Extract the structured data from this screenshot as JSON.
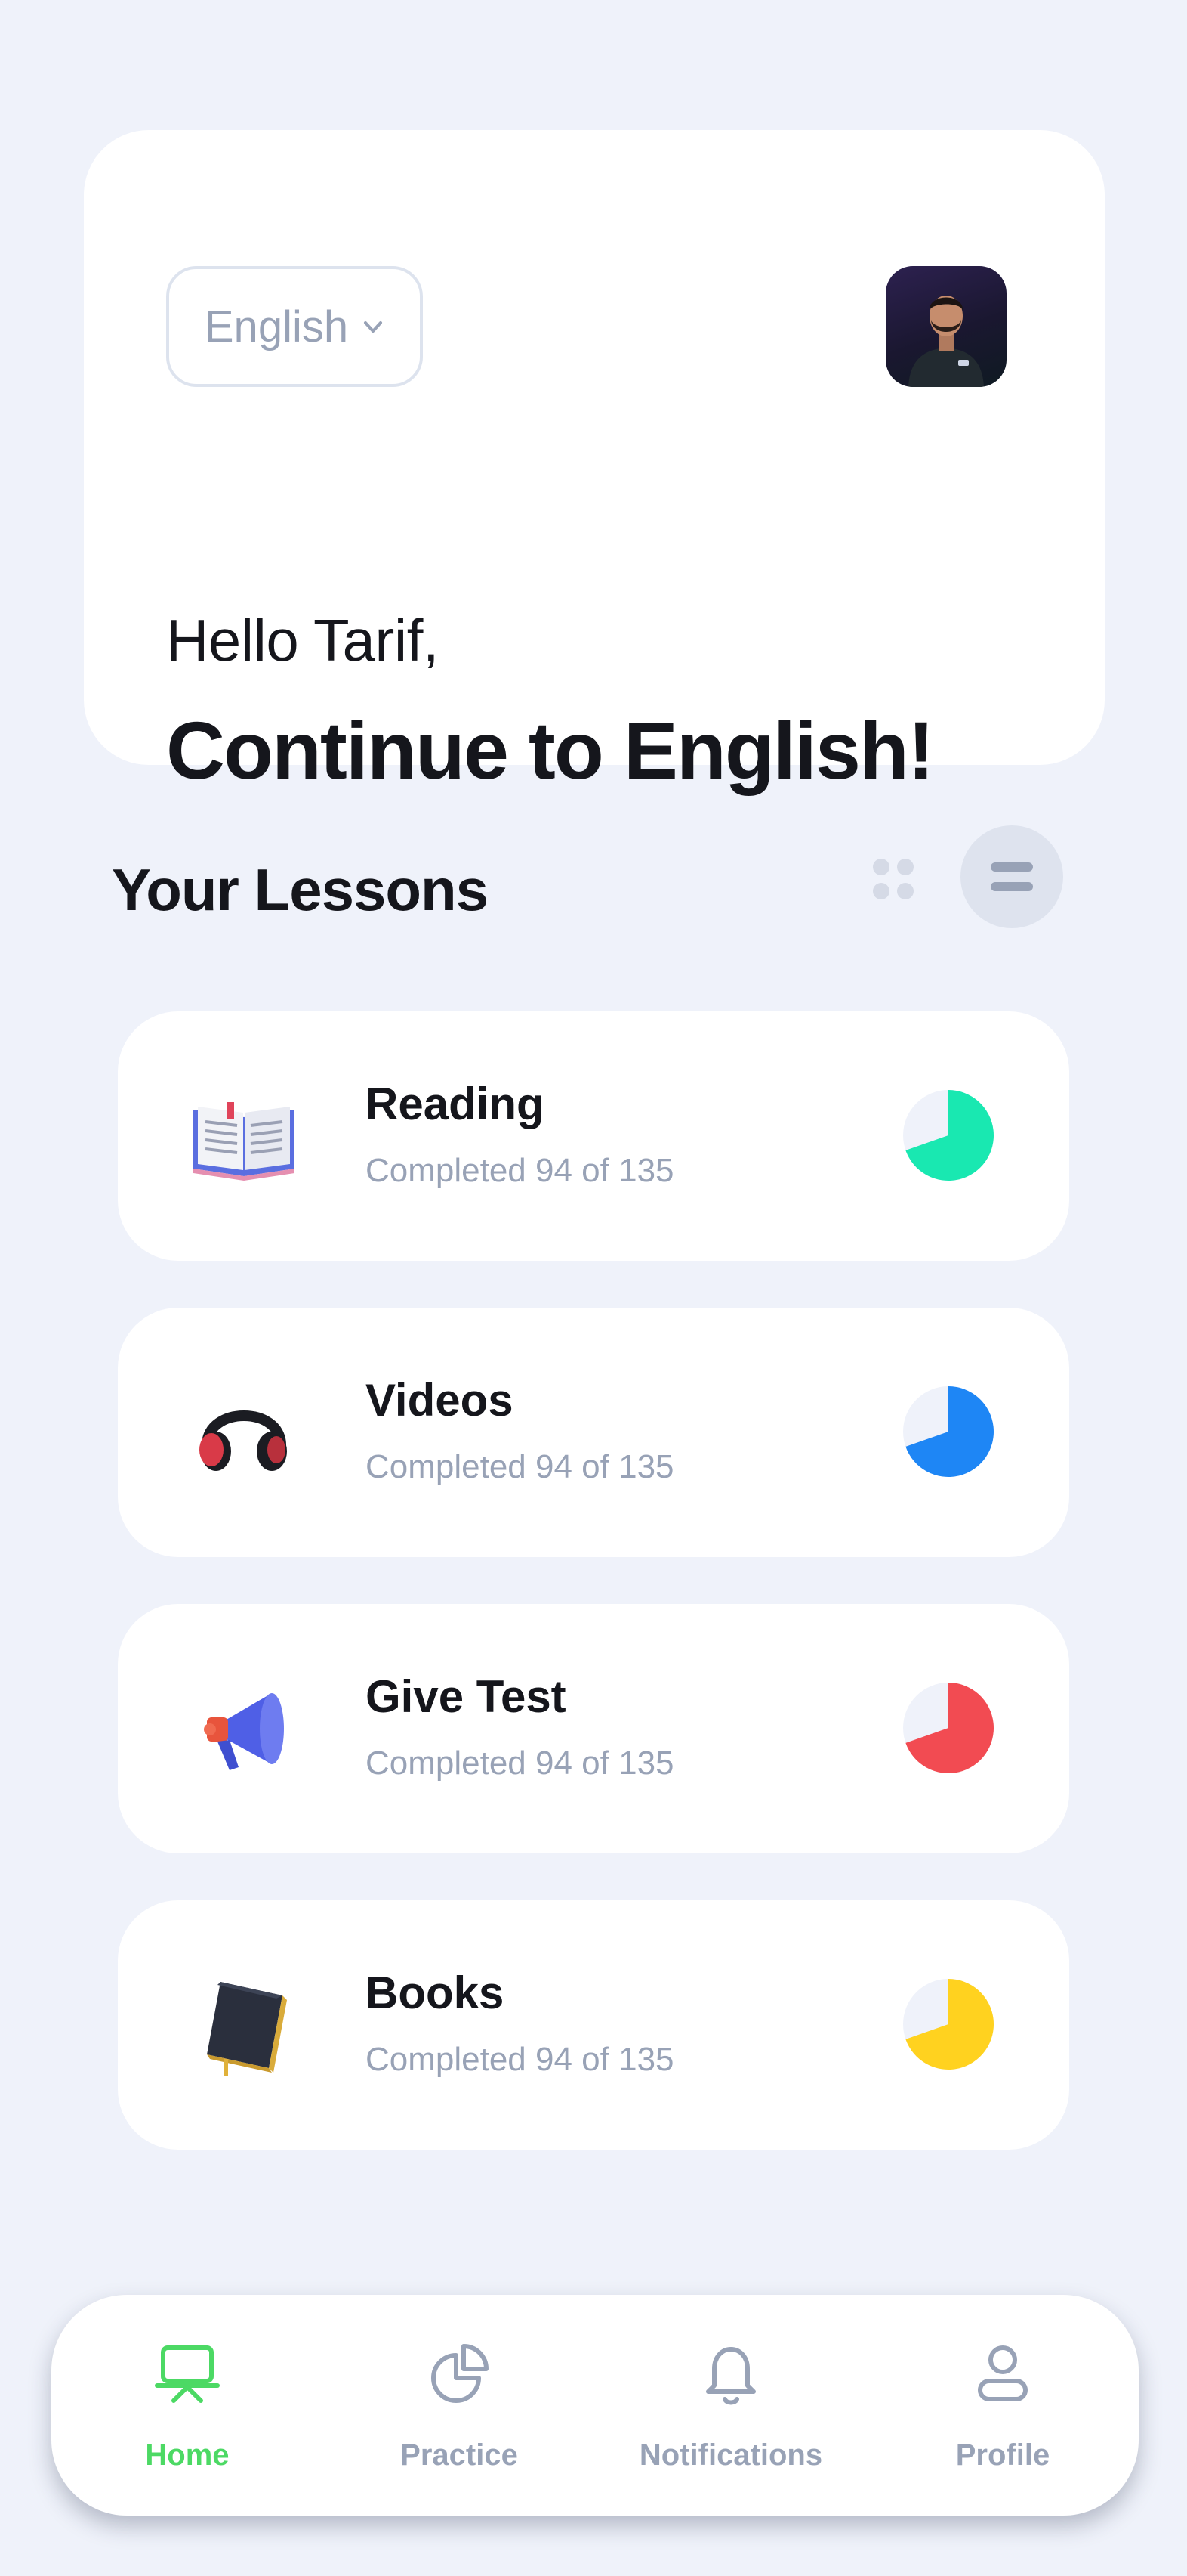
{
  "header": {
    "language": "English",
    "greeting": "Hello Tarif,",
    "headline": "Continue to English!"
  },
  "section": {
    "title": "Your Lessons"
  },
  "lessons": [
    {
      "title": "Reading",
      "subtitle": "Completed 94 of 135",
      "completed": 94,
      "total": 135,
      "icon": "open-book-icon",
      "color": "#19E8B1"
    },
    {
      "title": "Videos",
      "subtitle": "Completed 94 of 135",
      "completed": 94,
      "total": 135,
      "icon": "headphones-icon",
      "color": "#1E86F5"
    },
    {
      "title": "Give Test",
      "subtitle": "Completed 94 of 135",
      "completed": 94,
      "total": 135,
      "icon": "megaphone-icon",
      "color": "#F24B52"
    },
    {
      "title": "Books",
      "subtitle": "Completed 94 of 135",
      "completed": 94,
      "total": 135,
      "icon": "book-icon",
      "color": "#FFD21F"
    }
  ],
  "nav": {
    "items": [
      {
        "label": "Home",
        "icon": "presentation-board-icon",
        "active": true
      },
      {
        "label": "Practice",
        "icon": "pie-chart-icon",
        "active": false
      },
      {
        "label": "Notifications",
        "icon": "bell-icon",
        "active": false
      },
      {
        "label": "Profile",
        "icon": "user-icon",
        "active": false
      }
    ]
  },
  "colors": {
    "background": "#EFF2FA",
    "accent_green": "#4CD964",
    "muted_text": "#98A2B6",
    "primary_text": "#15161C"
  }
}
